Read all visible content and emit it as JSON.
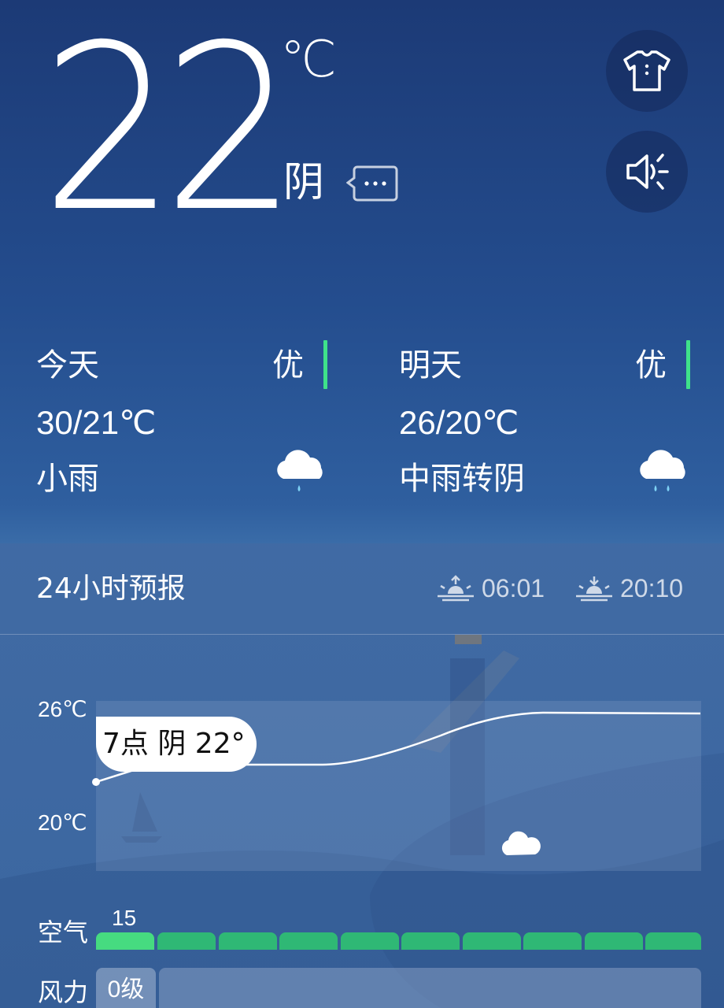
{
  "current": {
    "temperature": "22",
    "unit": "℃",
    "condition": "阴",
    "icons": [
      "chat-bubble-icon",
      "shirt-icon",
      "speaker-icon"
    ]
  },
  "today": {
    "label": "今天",
    "air_quality": "优",
    "range": "30/21℃",
    "condition": "小雨",
    "icon": "light-rain-cloud-icon"
  },
  "tomorrow": {
    "label": "明天",
    "air_quality": "优",
    "range": "26/20℃",
    "condition": "中雨转阴",
    "icon": "moderate-rain-cloud-icon"
  },
  "forecast": {
    "title": "24小时预报",
    "sunrise": "06:01",
    "sunset": "20:10",
    "y_top": "26℃",
    "y_bottom": "20℃",
    "tooltip": "7点 阴 22°",
    "air_label": "空气",
    "aqi_value": "15",
    "wind_label": "风力",
    "wind_first": "0级",
    "cloud_icon": "cloud-icon"
  },
  "colors": {
    "background_top": "#1c3a76",
    "background_mid": "#2f5f9f",
    "aq_good": "#3fe28a",
    "aq_segment": "#2fb875",
    "rain_drop": "#7fd3f5"
  }
}
